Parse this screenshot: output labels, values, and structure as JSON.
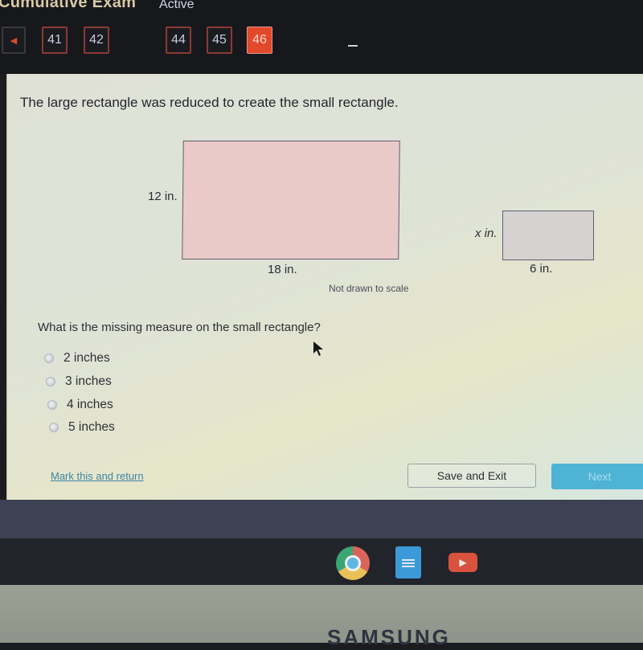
{
  "header": {
    "exam_title": "Cumulative Exam",
    "status": "Active",
    "back_icon": "triangle-left-icon",
    "question_nav": [
      {
        "label": "41",
        "active": false
      },
      {
        "label": "42",
        "active": false
      },
      {
        "label": "44",
        "active": false
      },
      {
        "label": "45",
        "active": false
      },
      {
        "label": "46",
        "active": true
      }
    ]
  },
  "question": {
    "intro": "The large rectangle was reduced to create the small rectangle.",
    "large_rect": {
      "height_label": "12 in.",
      "width_label": "18 in."
    },
    "small_rect": {
      "height_label": "x in.",
      "width_label": "6 in."
    },
    "note": "Not drawn to scale",
    "prompt": "What is the missing measure on the small rectangle?",
    "options": [
      "2 inches",
      "3 inches",
      "4 inches",
      "5 inches"
    ]
  },
  "footer": {
    "mark_link": "Mark this and return",
    "save_exit": "Save and Exit",
    "next": "Next"
  },
  "shelf": {
    "apps": [
      "chrome-icon",
      "docs-icon",
      "youtube-icon"
    ]
  },
  "device": {
    "brand": "SAMSUNG"
  },
  "colors": {
    "active_tab": "#e2482a",
    "next_button": "#4fb3d5",
    "link": "#3f84a8",
    "large_rect_fill": "#eac9c9"
  }
}
